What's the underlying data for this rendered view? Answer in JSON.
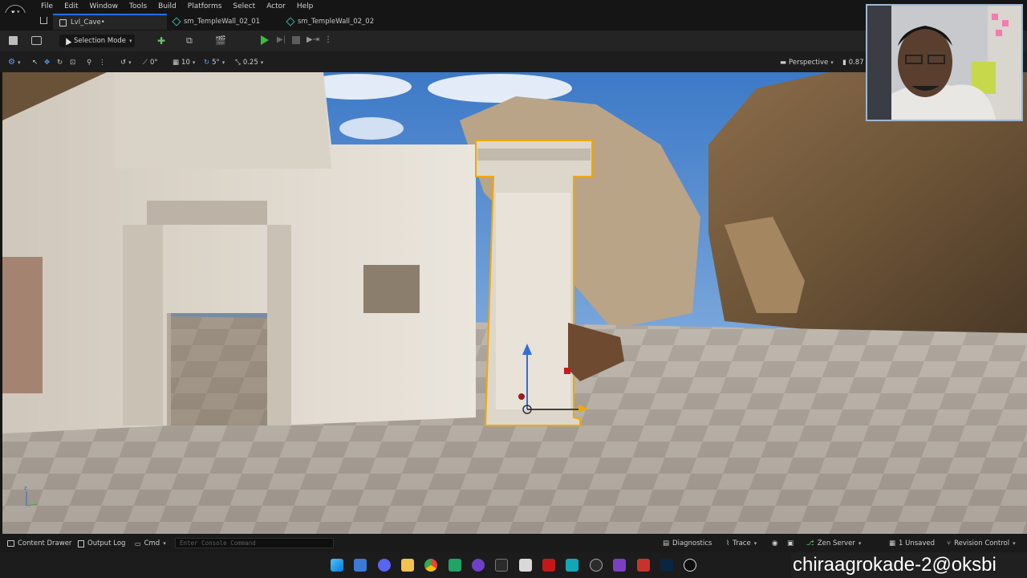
{
  "menu": {
    "items": [
      "File",
      "Edit",
      "Window",
      "Tools",
      "Build",
      "Platforms",
      "Select",
      "Actor",
      "Help"
    ]
  },
  "tabs": [
    {
      "label": "Lvl_Cave•",
      "active": true
    },
    {
      "label": "sm_TempleWall_02_01",
      "active": false
    },
    {
      "label": "sm_TempleWall_02_02",
      "active": false
    }
  ],
  "toolbar": {
    "selection_mode": "Selection Mode"
  },
  "viewport_toolbar": {
    "rotation_snap": "0°",
    "grid_snap": "10",
    "angle_snap": "5°",
    "scale_snap": "0.25",
    "view_mode": "Perspective",
    "camera_speed": "0.87"
  },
  "statusbar": {
    "content_drawer": "Content Drawer",
    "output_log": "Output Log",
    "cmd": "Cmd",
    "console_placeholder": "Enter Console Command",
    "diagnostics": "Diagnostics",
    "trace": "Trace",
    "zen_server": "Zen Server",
    "unsaved": "1 Unsaved",
    "revision_control": "Revision Control"
  },
  "watermark": "chiraagrokade-2@oksbi",
  "colors": {
    "accent_blue": "#1f6feb",
    "play_green": "#3dbb3d",
    "selection_outline": "#f2a700",
    "asset_tab_icon": "#2fb3a8"
  }
}
